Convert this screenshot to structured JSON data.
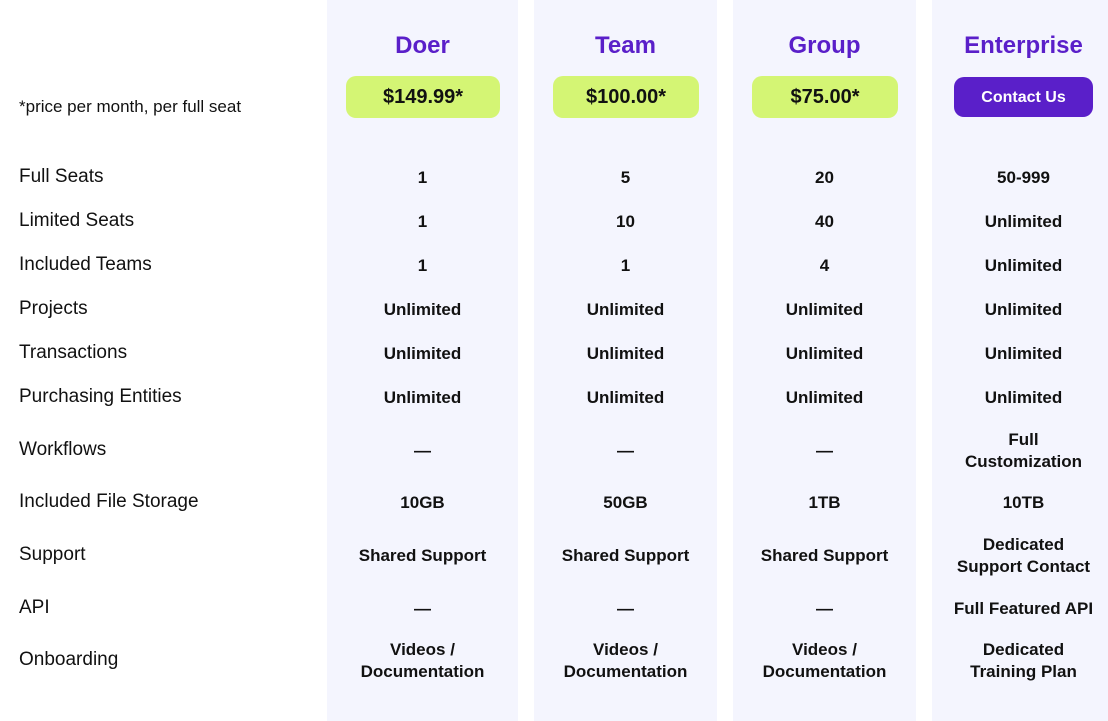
{
  "note": "*price per month, per full seat",
  "plans": [
    {
      "name": "Doer",
      "price": "$149.99*"
    },
    {
      "name": "Team",
      "price": "$100.00*"
    },
    {
      "name": "Group",
      "price": "$75.00*"
    },
    {
      "name": "Enterprise",
      "cta": "Contact Us"
    }
  ],
  "features": [
    {
      "label": "Full Seats",
      "values": [
        "1",
        "5",
        "20",
        "50-999"
      ]
    },
    {
      "label": "Limited Seats",
      "values": [
        "1",
        "10",
        "40",
        "Unlimited"
      ]
    },
    {
      "label": "Included Teams",
      "values": [
        "1",
        "1",
        "4",
        "Unlimited"
      ]
    },
    {
      "label": "Projects",
      "values": [
        "Unlimited",
        "Unlimited",
        "Unlimited",
        "Unlimited"
      ]
    },
    {
      "label": "Transactions",
      "values": [
        "Unlimited",
        "Unlimited",
        "Unlimited",
        "Unlimited"
      ]
    },
    {
      "label": "Purchasing Entities",
      "values": [
        "Unlimited",
        "Unlimited",
        "Unlimited",
        "Unlimited"
      ]
    },
    {
      "label": "Workflows",
      "values": [
        "—",
        "—",
        "—",
        "Full\nCustomization"
      ]
    },
    {
      "label": "Included File Storage",
      "values": [
        "10GB",
        "50GB",
        "1TB",
        "10TB"
      ]
    },
    {
      "label": "Support",
      "values": [
        "Shared Support",
        "Shared Support",
        "Shared Support",
        "Dedicated\nSupport Contact"
      ]
    },
    {
      "label": "API",
      "values": [
        "—",
        "—",
        "—",
        "Full Featured API"
      ]
    },
    {
      "label": "Onboarding",
      "values": [
        "Videos /\nDocumentation",
        "Videos /\nDocumentation",
        "Videos /\nDocumentation",
        "Dedicated\nTraining Plan"
      ]
    }
  ],
  "colors": {
    "accent": "#5a1fc9",
    "price_bg": "#d4f574",
    "column_bg": "#f4f5fe"
  }
}
